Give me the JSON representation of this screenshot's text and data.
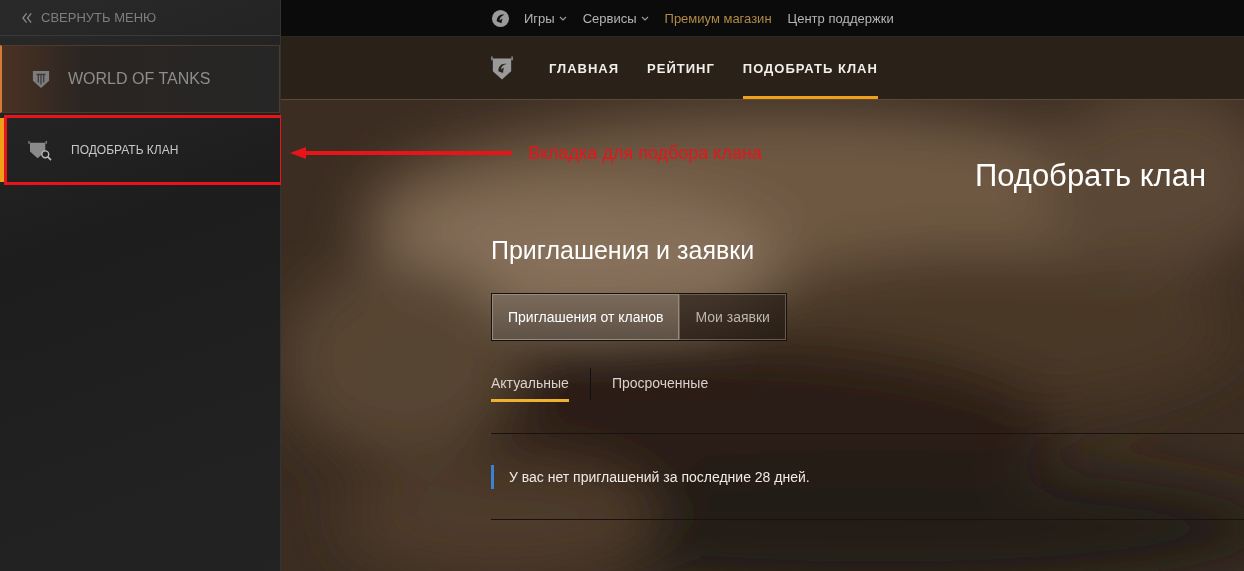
{
  "sidebar": {
    "collapse_label": "СВЕРНУТЬ МЕНЮ",
    "items": [
      {
        "kind": "game",
        "label": "WORLD OF TANKS",
        "selected": false
      },
      {
        "kind": "section",
        "label": "ПОДОБРАТЬ КЛАН",
        "selected": true
      }
    ]
  },
  "top_bar": {
    "links": [
      {
        "label": "Игры",
        "dropdown": true,
        "highlight": false
      },
      {
        "label": "Сервисы",
        "dropdown": true,
        "highlight": false
      },
      {
        "label": "Премиум магазин",
        "dropdown": false,
        "highlight": true
      },
      {
        "label": "Центр поддержки",
        "dropdown": false,
        "highlight": false
      }
    ]
  },
  "nav_tabs": [
    {
      "label": "ГЛАВНАЯ",
      "selected": false
    },
    {
      "label": "РЕЙТИНГ",
      "selected": false
    },
    {
      "label": "ПОДОБРАТЬ КЛАН",
      "selected": true
    }
  ],
  "page_title": "Подобрать клан",
  "section_title": "Приглашения и заявки",
  "segments": [
    {
      "label": "Приглашения от кланов",
      "selected": true
    },
    {
      "label": "Мои заявки",
      "selected": false
    }
  ],
  "subtabs": [
    {
      "label": "Актуальные",
      "selected": true
    },
    {
      "label": "Просроченные",
      "selected": false
    }
  ],
  "notice": "У вас нет приглашений за последние 28 дней.",
  "annotation": {
    "text": "Вкладка для подбора клана"
  }
}
